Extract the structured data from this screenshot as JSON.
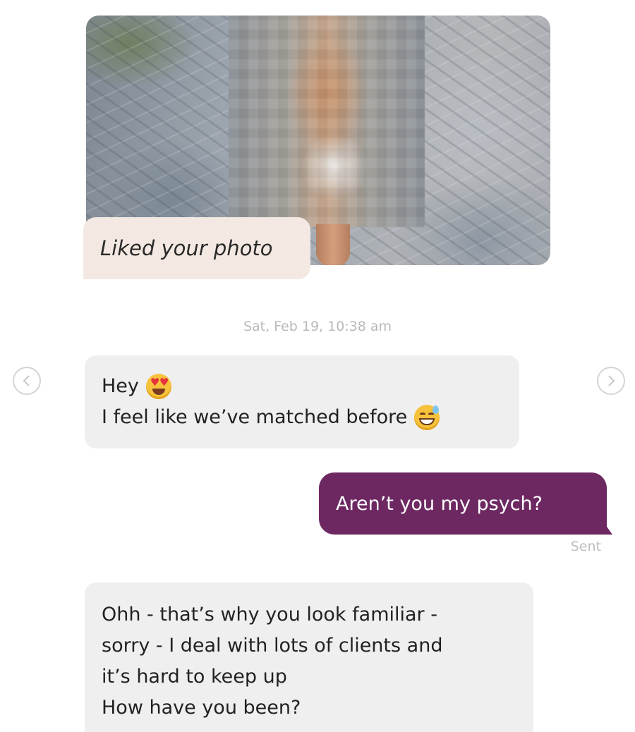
{
  "liked_photo": {
    "label": "Liked your photo"
  },
  "timestamp": "Sat, Feb 19, 10:38 am",
  "nav": {
    "prev_icon": "chevron-left-icon",
    "next_icon": "chevron-right-icon"
  },
  "messages": [
    {
      "direction": "incoming",
      "lines": [
        "Hey",
        "I feel like we’ve matched before"
      ],
      "emojis": [
        "heart-eyes-emoji",
        "grinning-sweat-emoji"
      ]
    },
    {
      "direction": "outgoing",
      "text": "Aren’t you my psych?",
      "status": "Sent"
    },
    {
      "direction": "incoming",
      "lines": [
        "Ohh - that’s why you look familiar -",
        "sorry - I deal with lots of clients and",
        "it’s hard to keep up",
        "How have you been?"
      ]
    }
  ],
  "colors": {
    "outgoing_bubble": "#6d2862",
    "incoming_bubble": "#efefef",
    "liked_label_bg": "#f3e9e2",
    "meta_text": "#b9b9b9"
  }
}
